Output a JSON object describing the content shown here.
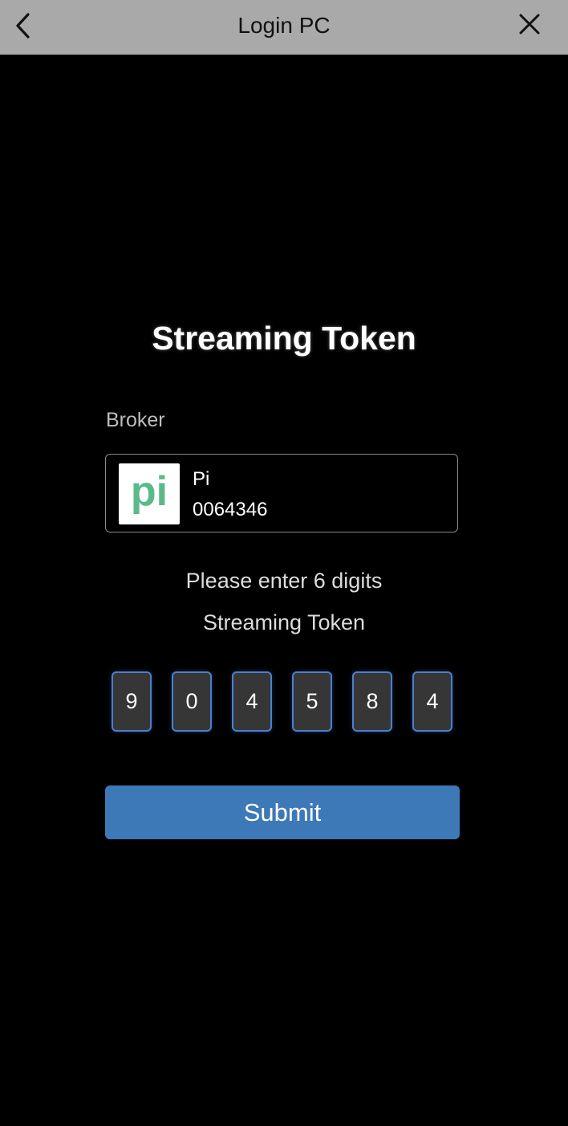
{
  "header": {
    "title": "Login PC",
    "back_icon": "chevron-left-icon",
    "close_icon": "close-icon"
  },
  "main": {
    "title": "Streaming Token",
    "broker": {
      "label": "Broker",
      "logo_text": "pi",
      "logo_color": "#5bb98a",
      "name": "Pi",
      "account": "0064346"
    },
    "instruction_line1": "Please enter 6 digits",
    "instruction_line2": "Streaming Token",
    "token_digits": [
      "9",
      "0",
      "4",
      "5",
      "8",
      "4"
    ],
    "submit_label": "Submit"
  },
  "colors": {
    "header_bg": "#a9a9a9",
    "background": "#000000",
    "accent": "#3d78b7",
    "digit_border": "#4a7fd0"
  }
}
